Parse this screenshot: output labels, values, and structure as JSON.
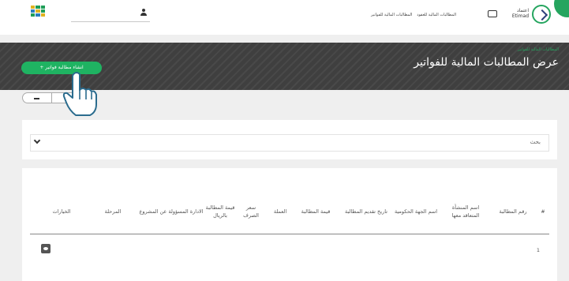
{
  "top_bar": {
    "grid_colors": [
      "#e0b320",
      "#1e9e57",
      "#1e9e57",
      "#2a7fbf",
      "#e0b320",
      "#1e9e57",
      "#1e9e57",
      "#2a7fbf",
      "#e0b320"
    ],
    "nav": [
      "المطالبات المالية للعقود",
      "المطالبات المالية للفواتير"
    ],
    "brand_ar": "اعتماد",
    "brand_en": "Etimad"
  },
  "header": {
    "breadcrumb": "المطالبات المالية للفواتير",
    "title": "عرض المطالبات المالية للفواتير",
    "new_button": "+ انشاء مطالبة فواتير"
  },
  "search": {
    "label": "بحث"
  },
  "table": {
    "columns": [
      "#",
      "رقم المطالبة",
      "اسم المنشأة المتعاقد معها",
      "اسم الجهة الحكومية",
      "تاريخ تقديم المطالبة",
      "قيمة المطالبة",
      "العملة",
      "سعر الصرف",
      "قيمة المطالبة بالريال",
      "الادارة المسؤولة عن المشروع",
      "المرحلة",
      "الخيارات"
    ],
    "rows": [
      {
        "number": "1"
      }
    ]
  },
  "colors": {
    "accent": "#1fb362",
    "band": "#3f3f3f"
  }
}
